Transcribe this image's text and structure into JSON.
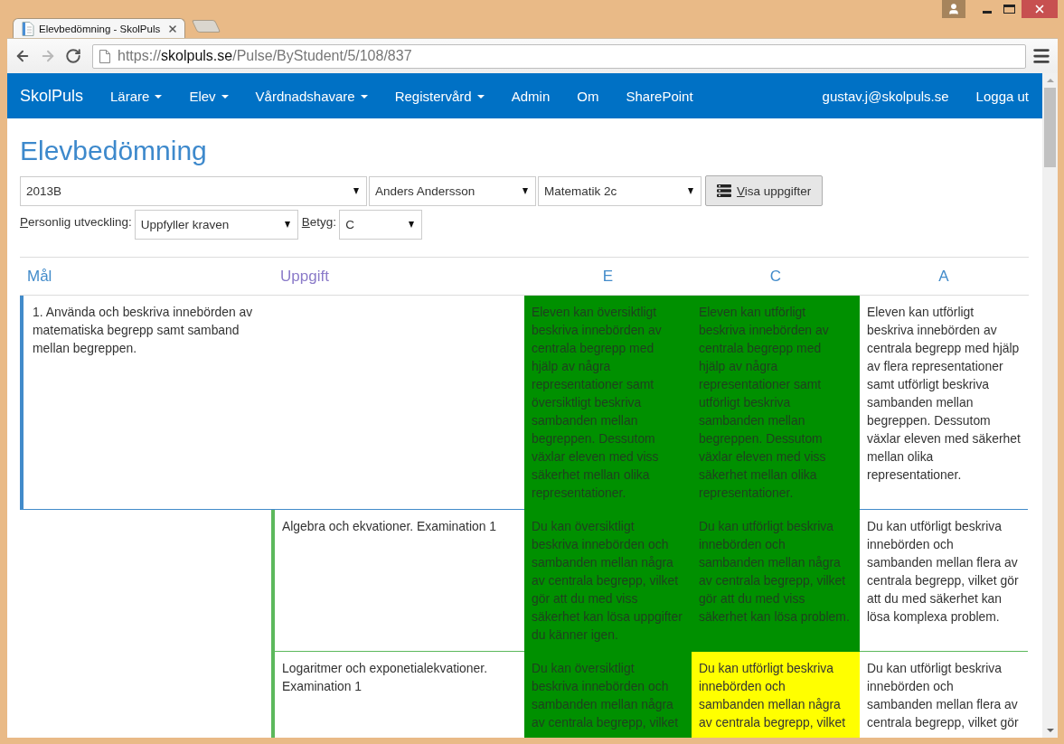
{
  "browser": {
    "tabs": [
      {
        "title": "Elevbedömning - SkolPuls",
        "selected": true
      }
    ],
    "nav_buttons": [
      {
        "kind": "back",
        "disabled": false
      },
      {
        "kind": "forward",
        "disabled": true
      },
      {
        "kind": "reload",
        "disabled": false
      }
    ],
    "url": "https://**skolpuls.se**/Pulse/ByStudent/5/108/837"
  },
  "navbar": {
    "brand": "SkolPuls",
    "items": [
      {
        "label": "Lärare",
        "dropdown": true
      },
      {
        "label": "Elev",
        "dropdown": true
      },
      {
        "label": "Vårdnadshavare",
        "dropdown": true
      },
      {
        "label": "Registervård",
        "dropdown": true
      },
      {
        "label": "Admin",
        "dropdown": false
      },
      {
        "label": "Om",
        "dropdown": false
      },
      {
        "label": "SharePoint",
        "dropdown": false
      }
    ],
    "user": "gustav.j@skolpuls.se",
    "logout": "Logga ut"
  },
  "page": {
    "title": "Elevbedömning"
  },
  "filters": {
    "selects": [
      "2013B",
      "Anders Andersson",
      "Matematik 2c"
    ],
    "button": "Visa uppgifter"
  },
  "fields": [
    {
      "label": "Personlig utveckling:",
      "value": "Uppfyller kraven"
    },
    {
      "label": "Betyg:",
      "value": "C"
    }
  ],
  "table": {
    "columns": [
      {
        "label": "Mål",
        "color": "#428bca"
      },
      {
        "label": "Uppgift",
        "color": "#8b7bc9"
      },
      {
        "label": "E",
        "color": "#428bca"
      },
      {
        "label": "C",
        "color": "#428bca"
      },
      {
        "label": "A",
        "color": "#428bca"
      }
    ],
    "rows": [
      {
        "kind": "goal",
        "text": "1. Använda och beskriva innebörden av matematiska begrepp samt samband mellan begreppen.",
        "grades": [
          {
            "text": "Eleven kan översiktligt beskriva innebörden av centrala begrepp med hjälp av några representationer samt översiktligt beskriva sambanden mellan begreppen. Dessutom växlar eleven med viss säkerhet mellan olika representationer.",
            "color": "#009000"
          },
          {
            "text": "Eleven kan utförligt beskriva innebörden av centrala begrepp med hjälp av några representationer samt utförligt beskriva sambanden mellan begreppen. Dessutom växlar eleven med viss säkerhet mellan olika representationer.",
            "color": "#009000"
          },
          {
            "text": "Eleven kan utförligt beskriva innebörden av centrala begrepp med hjälp av flera representationer samt utförligt beskriva sambanden mellan begreppen. Dessutom växlar eleven med säkerhet mellan olika representationer.",
            "color": "#ffffff"
          }
        ]
      },
      {
        "kind": "task",
        "text": "Algebra och ekvationer. Examination 1",
        "grades": [
          {
            "text": "Du kan översiktligt beskriva innebörden och sambanden mellan några av centrala begrepp, vilket gör att du med viss säkerhet kan lösa uppgifter du känner igen.",
            "color": "#009000"
          },
          {
            "text": "Du kan utförligt beskriva innebörden och sambanden mellan några av centrala begrepp, vilket gör att du med viss säkerhet kan lösa problem.",
            "color": "#009000"
          },
          {
            "text": "Du kan utförligt beskriva innebörden och sambanden mellan flera av centrala begrepp, vilket gör att du med säkerhet kan lösa komplexa problem.",
            "color": "#ffffff"
          }
        ]
      },
      {
        "kind": "task",
        "text": "Logaritmer och exponetialekvationer. Examination 1",
        "grades": [
          {
            "text": "Du kan översiktligt beskriva innebörden och sambanden mellan några av centrala begrepp, vilket",
            "color": "#009000"
          },
          {
            "text": "Du kan utförligt beskriva innebörden och sambanden mellan några av centrala begrepp, vilket",
            "color": "#ffff00"
          },
          {
            "text": "Du kan utförligt beskriva innebörden och sambanden mellan flera av centrala begrepp, vilket gör",
            "color": "#ffffff"
          }
        ]
      }
    ]
  }
}
